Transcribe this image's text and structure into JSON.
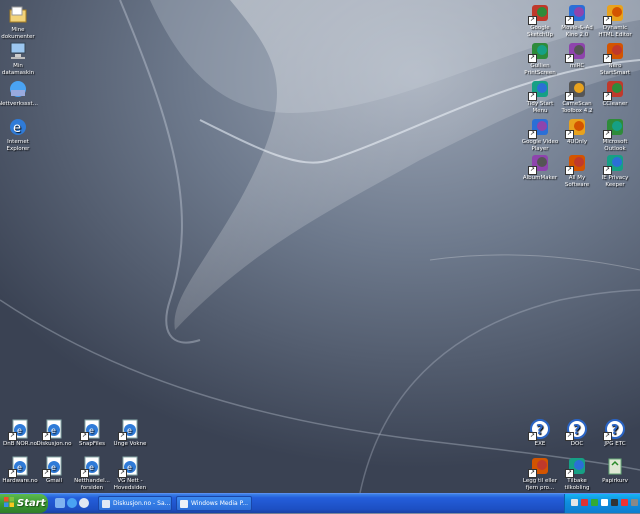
{
  "desktop_left_top": [
    {
      "name": "my-documents-icon",
      "label": "Mine dokumenter"
    },
    {
      "name": "my-computer-icon",
      "label": "Min datamaskin"
    },
    {
      "name": "network-icon",
      "label": "Nettverkssst..."
    },
    {
      "name": "internet-explorer-icon",
      "label": "Internet Explorer"
    }
  ],
  "desktop_right_top": [
    {
      "name": "google-sketchup-icon",
      "label": "Google SketchUp"
    },
    {
      "name": "movie-maker-icon",
      "label": "Movie-&-Ad Kino 2.0"
    },
    {
      "name": "dynamic-html-editor-icon",
      "label": "Dynamic HTML Editor"
    },
    {
      "name": "gullien-printscreen-icon",
      "label": "Gullien PrintScreen"
    },
    {
      "name": "mirc-icon",
      "label": "mIRC"
    },
    {
      "name": "nero-startsmart-icon",
      "label": "Nero StartSmart"
    },
    {
      "name": "tidy-start-menu-icon",
      "label": "Tidy Start Menu"
    },
    {
      "name": "camstudio-toolbox-icon",
      "label": "CameScan Toolbox 4.2"
    },
    {
      "name": "ccleaner-icon",
      "label": "CCleaner"
    },
    {
      "name": "google-video-player-icon",
      "label": "Google Video Player"
    },
    {
      "name": "4uonly-icon",
      "label": "4UOnly"
    },
    {
      "name": "microsoft-outlook-icon",
      "label": "Microsoft Outlook"
    },
    {
      "name": "albummaker-icon",
      "label": "AlbumMaker"
    },
    {
      "name": "all-my-software-icon",
      "label": "All My Software"
    },
    {
      "name": "privacy-keeper-icon",
      "label": "IE Privacy Keeper"
    }
  ],
  "desktop_left_bottom": [
    {
      "name": "dnb-nor-icon",
      "label": "DnB NOR.no"
    },
    {
      "name": "diskusjon-icon",
      "label": "Diskusjon.no"
    },
    {
      "name": "snapfiles-icon",
      "label": "SnapFiles"
    },
    {
      "name": "unge-vokne-icon",
      "label": "Unge Vokne"
    },
    {
      "name": "hardware-icon",
      "label": "Hardware.no"
    },
    {
      "name": "gmail-icon",
      "label": "Gmail"
    },
    {
      "name": "netthandel-icon",
      "label": "Netthandel... forsiden"
    },
    {
      "name": "vg-nett-icon",
      "label": "VG Nett - Hovedsiden"
    }
  ],
  "desktop_right_bottom": [
    {
      "name": "exe-help-icon",
      "label": "EXE"
    },
    {
      "name": "doc-help-icon",
      "label": "DOC"
    },
    {
      "name": "jpg-etc-help-icon",
      "label": "JPG ETC"
    },
    {
      "name": "add-remove-programs-icon",
      "label": "Legg til eller fjern pro..."
    },
    {
      "name": "tilbake-restore-icon",
      "label": "Tilbake tilkobling"
    },
    {
      "name": "recycle-bin-icon",
      "label": "Papirkurv"
    }
  ],
  "taskbar": {
    "start_label": "Start",
    "tasks": [
      {
        "label": "Diskusjon.no - Sa..."
      },
      {
        "label": "Windows Media P..."
      }
    ]
  },
  "colors": {
    "taskbar": "#245edb",
    "start": "#3c9a33",
    "tray": "#0f8fdf"
  }
}
